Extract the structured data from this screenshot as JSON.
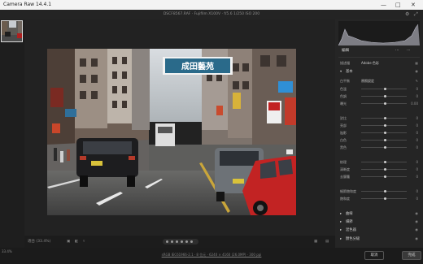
{
  "app": {
    "title": "Camera Raw 14.4.1"
  },
  "window_controls": {
    "minimize": "—",
    "maximize": "□",
    "close": "✕"
  },
  "topbar": {
    "file_info": "DSCF8567.RAF  ·  Fujifilm  X100V  ·  f/5.6  1/250  ISO 200"
  },
  "canvas": {
    "storefront_sign": "成田藝苑",
    "zoom_readout": "適合 (33.4%)",
    "zoom_value": "33.4%"
  },
  "panel": {
    "tabs": [
      "編輯",
      "⋯",
      "⋯"
    ],
    "profile": {
      "label": "描述檔",
      "value": "Adobe 色彩"
    },
    "sections": {
      "basic": "基本",
      "curve": "曲線",
      "detail": "細節",
      "color_mixer": "混色器",
      "color_grading": "顏色分級"
    },
    "white_balance": {
      "label": "白平衡",
      "value": "原照設定"
    },
    "sliders": [
      {
        "label": "色溫",
        "value": "0"
      },
      {
        "label": "色調",
        "value": "0"
      },
      {
        "label": "曝光",
        "value": "0.00"
      },
      {
        "label": "對比",
        "value": "0"
      },
      {
        "label": "亮部",
        "value": "0"
      },
      {
        "label": "陰影",
        "value": "0"
      },
      {
        "label": "白色",
        "value": "0"
      },
      {
        "label": "黑色",
        "value": "0"
      },
      {
        "label": "紋理",
        "value": "0"
      },
      {
        "label": "清晰度",
        "value": "0"
      },
      {
        "label": "去朦朧",
        "value": "0"
      },
      {
        "label": "細節飽和度",
        "value": "0"
      },
      {
        "label": "飽和度",
        "value": "0"
      }
    ]
  },
  "statusbar": {
    "metadata": "sRGB IEC61966-2.1 · 8 位元 · 6240 × 4160 (26.0MP) · 300 ppi",
    "cancel": "取消",
    "done": "完成"
  },
  "colors": {
    "accent": "#2f8fd6",
    "taxi_red": "#c22323",
    "panel_bg": "#252525"
  }
}
